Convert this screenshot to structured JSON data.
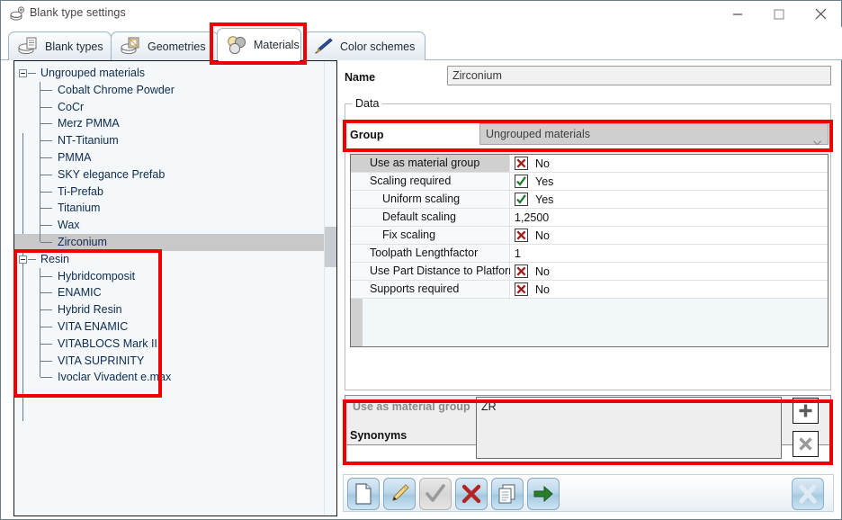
{
  "window": {
    "title": "Blank type settings",
    "icon": "settings-gear-icon",
    "minimize_label": "Minimize",
    "maximize_label": "Maximize",
    "close_label": "Close"
  },
  "tabs": [
    {
      "label": "Blank types",
      "icon": "blank-disc-icon",
      "active": false
    },
    {
      "label": "Geometries",
      "icon": "geometry-disc-icon",
      "active": false
    },
    {
      "label": "Materials",
      "icon": "materials-dots-icon",
      "active": true
    },
    {
      "label": "Color schemes",
      "icon": "paintbrush-icon",
      "active": false
    }
  ],
  "tree": {
    "groups": [
      {
        "label": "Ungrouped materials",
        "expanded": true,
        "children": [
          {
            "label": "Cobalt Chrome Powder",
            "selected": false
          },
          {
            "label": "CoCr",
            "selected": false
          },
          {
            "label": "Merz PMMA",
            "selected": false
          },
          {
            "label": "NT-Titanium",
            "selected": false
          },
          {
            "label": "PMMA",
            "selected": false
          },
          {
            "label": "SKY elegance Prefab",
            "selected": false
          },
          {
            "label": "Ti-Prefab",
            "selected": false
          },
          {
            "label": "Titanium",
            "selected": false
          },
          {
            "label": "Wax",
            "selected": false
          },
          {
            "label": "Zirconium",
            "selected": true
          }
        ]
      },
      {
        "label": "Resin",
        "expanded": true,
        "children": [
          {
            "label": "Hybridcomposit",
            "selected": false
          },
          {
            "label": "ENAMIC",
            "selected": false
          },
          {
            "label": "Hybrid Resin",
            "selected": false
          },
          {
            "label": "VITA ENAMIC",
            "selected": false
          },
          {
            "label": "VITABLOCS Mark II",
            "selected": false
          },
          {
            "label": "VITA SUPRINITY",
            "selected": false
          },
          {
            "label": "Ivoclar Vivadent e.max",
            "selected": false
          }
        ]
      }
    ]
  },
  "details": {
    "name_label": "Name",
    "name_value": "Zirconium",
    "data_group_title": "Data",
    "group_label": "Group",
    "group_value": "Ungrouped materials",
    "properties": [
      {
        "name": "Use as material group",
        "type": "bool",
        "value": "No",
        "checked": false,
        "indent": false,
        "selected": true
      },
      {
        "name": "Scaling required",
        "type": "bool",
        "value": "Yes",
        "checked": true,
        "indent": false,
        "selected": false
      },
      {
        "name": "Uniform scaling",
        "type": "bool",
        "value": "Yes",
        "checked": true,
        "indent": true,
        "selected": false
      },
      {
        "name": "Default scaling",
        "type": "text",
        "value": "1,2500",
        "checked": null,
        "indent": true,
        "selected": false
      },
      {
        "name": "Fix scaling",
        "type": "bool",
        "value": "No",
        "checked": false,
        "indent": true,
        "selected": false
      },
      {
        "name": "Toolpath Lengthfactor",
        "type": "text",
        "value": "1",
        "checked": null,
        "indent": false,
        "selected": false
      },
      {
        "name": "Use Part Distance to Platform",
        "type": "bool",
        "value": "No",
        "checked": false,
        "indent": false,
        "selected": false
      },
      {
        "name": "Supports required",
        "type": "bool",
        "value": "No",
        "checked": false,
        "indent": false,
        "selected": false
      }
    ],
    "description_text": "Use as material group",
    "synonyms_label": "Synonyms",
    "synonyms_value": "ZR",
    "synonym_add_label": "+",
    "synonym_delete_label": "X"
  },
  "toolbar": {
    "buttons": [
      {
        "name": "new",
        "icon": "new-document-icon",
        "disabled": false
      },
      {
        "name": "edit",
        "icon": "pencil-edit-icon",
        "disabled": false
      },
      {
        "name": "accept",
        "icon": "checkmark-icon",
        "disabled": true
      },
      {
        "name": "delete",
        "icon": "red-x-icon",
        "disabled": false
      },
      {
        "name": "copy",
        "icon": "copy-pages-icon",
        "disabled": false
      },
      {
        "name": "apply",
        "icon": "green-arrow-icon",
        "disabled": false
      }
    ],
    "close_button": {
      "name": "close",
      "icon": "blue-x-icon",
      "label": "X"
    }
  },
  "annotations": {
    "colour": "#ef0000",
    "highlights": [
      "materials-tab",
      "resin-group-subtree",
      "group-dropdown-row",
      "synonyms-row"
    ]
  }
}
